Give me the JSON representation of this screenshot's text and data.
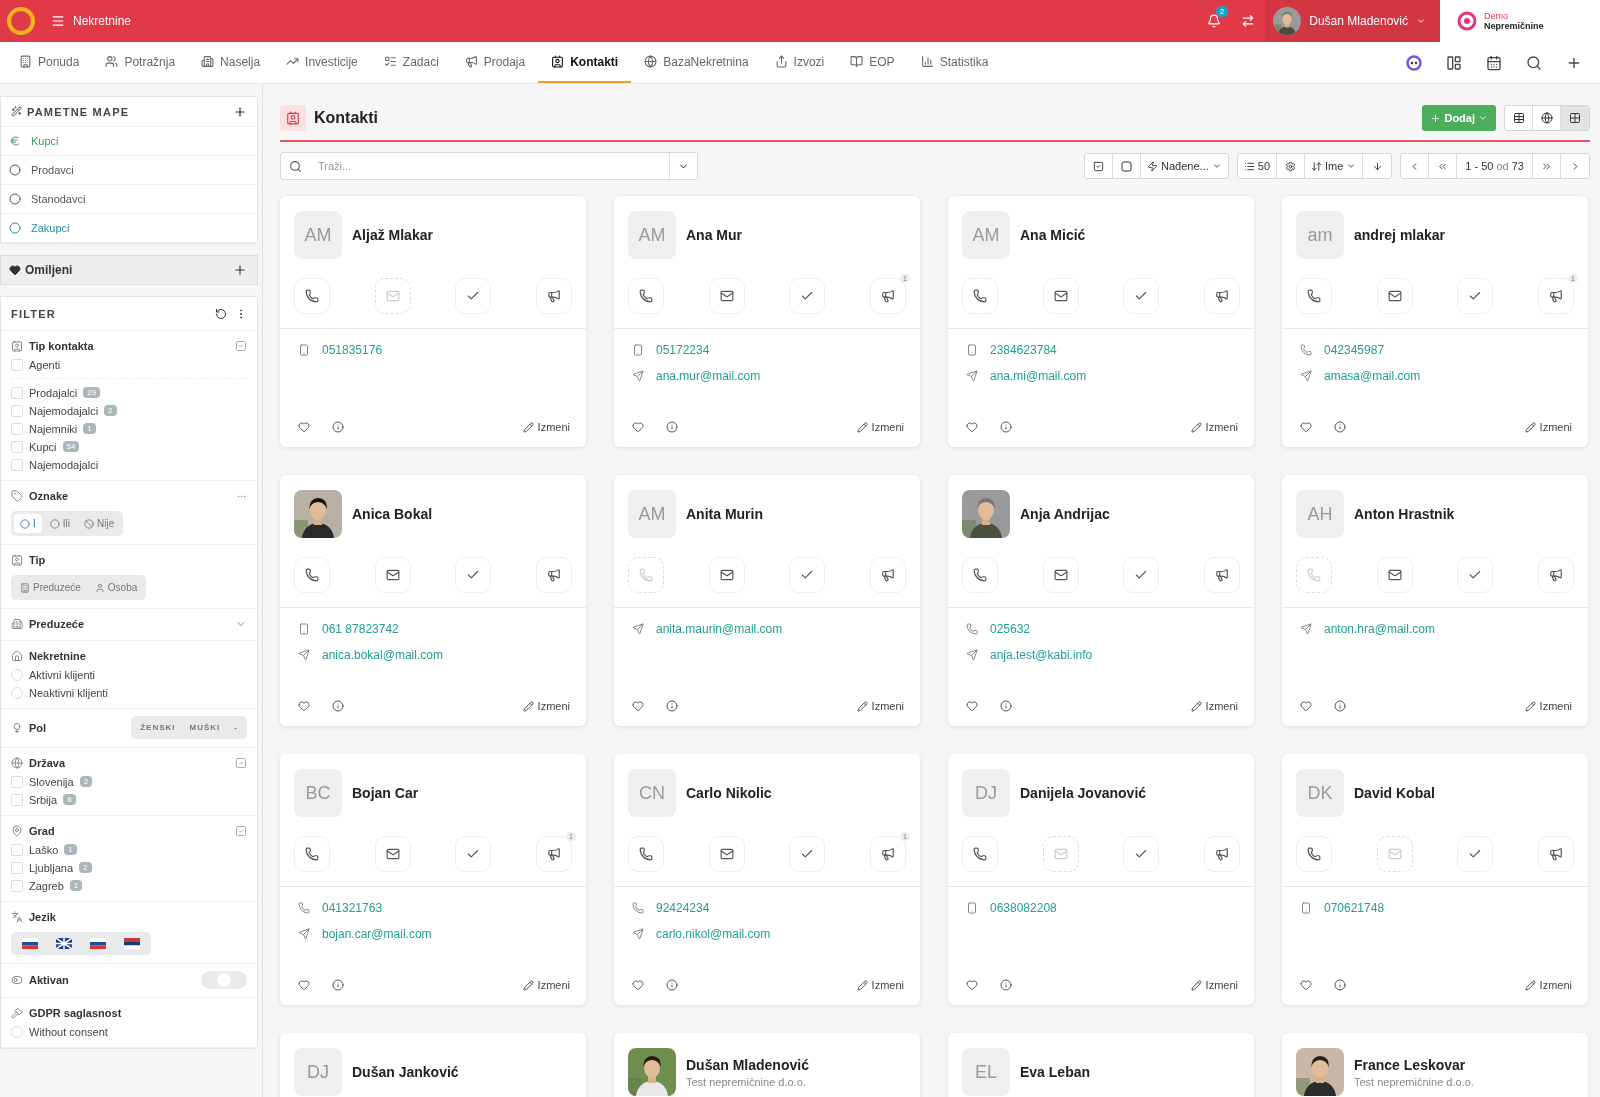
{
  "topbar": {
    "app_title": "Nekretnine",
    "notifications": "2",
    "user": "Dušan Mladenović",
    "brand_top": "Demo",
    "brand_bottom": "Nepremičnine"
  },
  "nav": [
    {
      "label": "Ponuda",
      "selected": false
    },
    {
      "label": "Potražnja",
      "selected": false
    },
    {
      "label": "Naselja",
      "selected": false
    },
    {
      "label": "Investicije",
      "selected": false
    },
    {
      "label": "Zadaci",
      "selected": false
    },
    {
      "label": "Prodaja",
      "selected": false
    },
    {
      "label": "Kontakti",
      "selected": true
    },
    {
      "label": "BazaNekretnina",
      "selected": false
    },
    {
      "label": "Izvozi",
      "selected": false
    },
    {
      "label": "EOP",
      "selected": false
    },
    {
      "label": "Statistika",
      "selected": false
    }
  ],
  "smart_folders": {
    "title": "PAMETNE MAPE",
    "items": [
      {
        "label": "Kupci",
        "kind": "euro",
        "color": "#3d9a5a"
      },
      {
        "label": "Prodavci",
        "kind": "circle",
        "color": "#555555"
      },
      {
        "label": "Stanodavci",
        "kind": "circle",
        "color": "#555555"
      },
      {
        "label": "Zakupci",
        "kind": "circle",
        "color": "#2a8fa0"
      }
    ]
  },
  "favorites": {
    "label": "Omiljeni"
  },
  "filter": {
    "title": "FILTER",
    "sections": [
      {
        "kind": "checklist",
        "title": "Tip kontakta",
        "groups": [
          [
            {
              "label": "Agenti",
              "checked": false
            }
          ],
          [
            {
              "label": "Prodajalci",
              "count": "29",
              "checked": false
            },
            {
              "label": "Najemodajalci",
              "count": "2",
              "checked": false
            },
            {
              "label": "Najemniki",
              "count": "1",
              "checked": false
            },
            {
              "label": "Kupci",
              "count": "54",
              "checked": false
            },
            {
              "label": "Najemodajalci",
              "checked": false
            }
          ]
        ]
      },
      {
        "kind": "segmented",
        "title": "Oznake",
        "options": [
          {
            "label": "I",
            "selected": true
          },
          {
            "label": "Ili",
            "selected": false
          },
          {
            "label": "Nije",
            "selected": false
          }
        ]
      },
      {
        "kind": "segmented",
        "title": "Tip",
        "options": [
          {
            "label": "Preduzeće",
            "selected": false
          },
          {
            "label": "Osoba",
            "selected": false
          }
        ]
      },
      {
        "kind": "dropdown",
        "title": "Preduzeće"
      },
      {
        "kind": "radio",
        "title": "Nekretnine",
        "items": [
          {
            "label": "Aktivni klijenti",
            "checked": false
          },
          {
            "label": "Neaktivni klijenti",
            "checked": false
          }
        ]
      },
      {
        "kind": "inline",
        "title": "Pol",
        "options": [
          {
            "label": "ŽENSKI",
            "selected": false
          },
          {
            "label": "MUŠKI",
            "selected": false
          },
          {
            "label": "-",
            "selected": false
          }
        ]
      },
      {
        "kind": "checklist",
        "title": "Država",
        "groups": [
          [
            {
              "label": "Slovenija",
              "count": "2",
              "checked": false
            },
            {
              "label": "Srbija",
              "count": "8",
              "checked": false
            }
          ]
        ]
      },
      {
        "kind": "checklist",
        "title": "Grad",
        "groups": [
          [
            {
              "label": "Laško",
              "count": "1",
              "checked": false
            },
            {
              "label": "Ljubljana",
              "count": "2",
              "checked": false
            },
            {
              "label": "Zagreb",
              "count": "1",
              "checked": false
            }
          ]
        ]
      },
      {
        "kind": "flags",
        "title": "Jezik"
      },
      {
        "kind": "toggle",
        "title": "Aktivan",
        "on": false
      },
      {
        "kind": "radio",
        "title": "GDPR saglasnost",
        "items": [
          {
            "label": "Without consent",
            "checked": false
          }
        ]
      }
    ]
  },
  "header": {
    "title": "Kontakti",
    "add": "Dodaj",
    "views": [
      {
        "selected": false
      },
      {
        "selected": false
      },
      {
        "selected": true
      }
    ]
  },
  "toolbar": {
    "search_placeholder": "Traži...",
    "found": "Nađene...",
    "page_size": "50",
    "sort": "Ime",
    "range": "1 - 50",
    "of": "od",
    "total": "73"
  },
  "contacts": [
    {
      "name": "Aljaž Mlakar",
      "initials": "AM",
      "phone_enabled": true,
      "email_enabled": false,
      "details": [
        {
          "kind": "mobile",
          "text": "051835176"
        }
      ],
      "edit": "Izmeni"
    },
    {
      "name": "Ana Mur",
      "initials": "AM",
      "phone_enabled": true,
      "email_enabled": true,
      "campaigns": "1",
      "details": [
        {
          "kind": "mobile",
          "text": "05172234"
        },
        {
          "kind": "email",
          "text": "ana.mur@mail.com"
        }
      ],
      "edit": "Izmeni"
    },
    {
      "name": "Ana Micić",
      "initials": "AM",
      "phone_enabled": true,
      "email_enabled": true,
      "details": [
        {
          "kind": "mobile",
          "text": "2384623784"
        },
        {
          "kind": "email",
          "text": "ana.mi@mail.com"
        }
      ],
      "edit": "Izmeni"
    },
    {
      "name": "andrej mlakar",
      "initials": "am",
      "phone_enabled": true,
      "email_enabled": true,
      "campaigns": "1",
      "details": [
        {
          "kind": "phone",
          "text": "042345987"
        },
        {
          "kind": "email",
          "text": "amasa@mail.com"
        }
      ],
      "edit": "Izmeni"
    },
    {
      "name": "Anica Bokal",
      "photo": true,
      "phone_enabled": true,
      "email_enabled": true,
      "details": [
        {
          "kind": "mobile",
          "text": "061 87823742"
        },
        {
          "kind": "email",
          "text": "anica.bokal@mail.com"
        }
      ],
      "edit": "Izmeni"
    },
    {
      "name": "Anita Murin",
      "initials": "AM",
      "phone_enabled": false,
      "email_enabled": true,
      "details": [
        {
          "kind": "email",
          "text": "anita.maurin@mail.com"
        }
      ],
      "edit": "Izmeni"
    },
    {
      "name": "Anja Andrijac",
      "photo": true,
      "phone_enabled": true,
      "email_enabled": true,
      "details": [
        {
          "kind": "phone",
          "text": "025632"
        },
        {
          "kind": "email",
          "text": "anja.test@kabi.info"
        }
      ],
      "edit": "Izmeni"
    },
    {
      "name": "Anton Hrastnik",
      "initials": "AH",
      "phone_enabled": false,
      "email_enabled": true,
      "details": [
        {
          "kind": "email",
          "text": "anton.hra@mail.com"
        }
      ],
      "edit": "Izmeni"
    },
    {
      "name": "Bojan Car",
      "initials": "BC",
      "phone_enabled": true,
      "email_enabled": true,
      "campaigns": "1",
      "details": [
        {
          "kind": "phone",
          "text": "041321763"
        },
        {
          "kind": "email",
          "text": "bojan.car@mail.com"
        }
      ],
      "edit": "Izmeni"
    },
    {
      "name": "Carlo Nikolic",
      "initials": "CN",
      "phone_enabled": true,
      "email_enabled": true,
      "campaigns": "1",
      "details": [
        {
          "kind": "phone",
          "text": "92424234"
        },
        {
          "kind": "email",
          "text": "carlo.nikol@mail.com"
        }
      ],
      "edit": "Izmeni"
    },
    {
      "name": "Danijela Jovanović",
      "initials": "DJ",
      "phone_enabled": true,
      "email_enabled": false,
      "details": [
        {
          "kind": "mobile",
          "text": "0638082208"
        }
      ],
      "edit": "Izmeni"
    },
    {
      "name": "David Kobal",
      "initials": "DK",
      "phone_enabled": true,
      "email_enabled": false,
      "details": [
        {
          "kind": "mobile",
          "text": "070621748"
        }
      ],
      "edit": "Izmeni"
    },
    {
      "name": "Dušan Janković",
      "initials": "DJ"
    },
    {
      "name": "Dušan Mladenović",
      "photo": true,
      "company": "Test nepremičnine d.o.o."
    },
    {
      "name": "Eva Leban",
      "initials": "EL"
    },
    {
      "name": "France Leskovar",
      "photo": true,
      "company": "Test nepremičnine d.o.o."
    }
  ]
}
